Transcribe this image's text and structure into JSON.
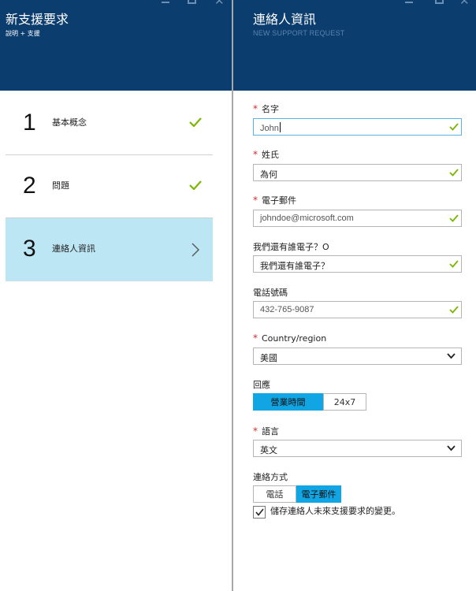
{
  "left_blade": {
    "title": "新支援要求",
    "subtitle": "說明 + 支援",
    "steps": [
      {
        "number": "1",
        "label": "基本概念",
        "status": "complete"
      },
      {
        "number": "2",
        "label": "問題",
        "status": "complete"
      },
      {
        "number": "3",
        "label": "連絡人資訊",
        "status": "active"
      }
    ]
  },
  "right_blade": {
    "title": "連絡人資訊",
    "subtitle": "NEW SUPPORT REQUEST"
  },
  "form": {
    "required_marker": "*",
    "first_name": {
      "label": "名字",
      "value": "John"
    },
    "last_name": {
      "label": "姓氏",
      "value": "為何"
    },
    "email": {
      "label": "電子郵件",
      "value": "johndoe@microsoft.com"
    },
    "additional_email": {
      "label": "我們還有誰電子？O",
      "value": "我們還有誰電子？"
    },
    "phone": {
      "label": "電話號碼",
      "value": "432-765-9087"
    },
    "country": {
      "label": "Country/region",
      "value": "美國"
    },
    "response": {
      "label": "回應",
      "options": [
        "營業時間",
        "24x7"
      ],
      "selected": "營業時間"
    },
    "language": {
      "label": "語言",
      "value": "英文"
    },
    "contact_method": {
      "label": "連絡方式",
      "options": [
        "電話",
        "電子郵件"
      ],
      "selected": "電子郵件"
    },
    "save_contact": {
      "label": "儲存連絡人未來支援要求的變更。",
      "checked": true
    }
  },
  "colors": {
    "header_bg": "#0b3d6e",
    "accent": "#12a5e4",
    "active_step_bg": "#bde6f5",
    "check_green": "#7ab800",
    "required_red": "#d12b2b"
  }
}
